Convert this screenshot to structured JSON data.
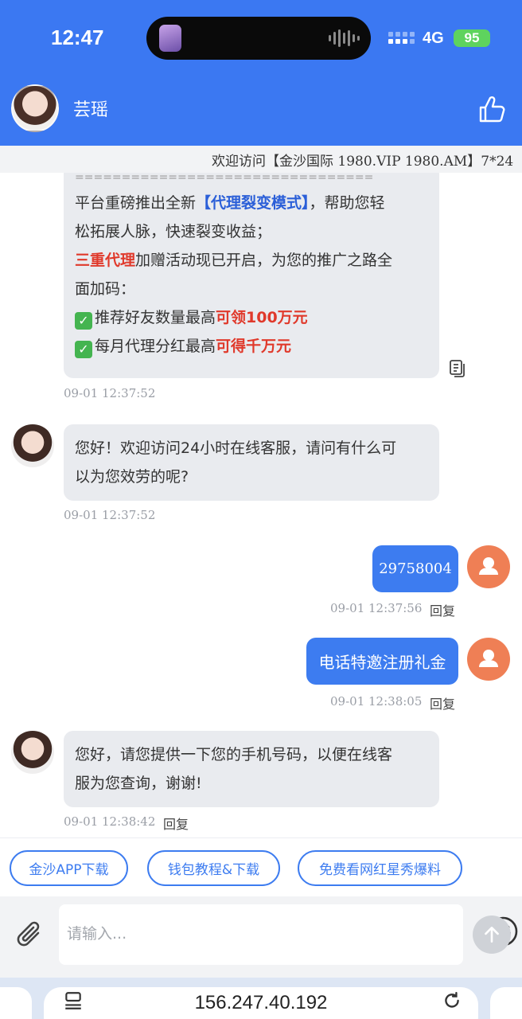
{
  "status_bar": {
    "time": "12:47",
    "network": "4G",
    "battery": "95"
  },
  "header": {
    "agent_name": "芸瑶"
  },
  "marquee": {
    "text": "欢迎访问【金沙国际 1980.VIP 1980.AM】7*24"
  },
  "messages": {
    "m1": {
      "divider": "================================",
      "l1a": "平台重磅推出全新",
      "l1b": "【代理裂变模式】",
      "l1c": "，帮助您轻",
      "l2": "松拓展人脉，快速裂变收益；",
      "l3a": "三重代理",
      "l3b": "加赠活动现已开启，为您的推广之路全",
      "l4": "面加码：",
      "l5a": "推荐好友数量最高",
      "l5b": "可领100万元",
      "l6a": "每月代理分红最高",
      "l6b": "可得千万元",
      "time": "09-01 12:37:52"
    },
    "m2": {
      "l1": "您好！欢迎访问24小时在线客服，请问有什么可",
      "l2": "以为您效劳的呢?",
      "time": "09-01 12:37:52"
    },
    "m3": {
      "text": "29758004",
      "time": "09-01 12:37:56",
      "reply": "回复"
    },
    "m4": {
      "text": "电话特邀注册礼金",
      "time": "09-01 12:38:05",
      "reply": "回复"
    },
    "m5": {
      "l1": "您好，请您提供一下您的手机号码，以便在线客",
      "l2": "服为您查询，谢谢!",
      "time": "09-01 12:38:42",
      "reply": "回复"
    }
  },
  "quick_buttons": [
    "金沙APP下载",
    "钱包教程&下载",
    "免费看网红星秀爆料"
  ],
  "input": {
    "placeholder": "请输入..."
  },
  "browser": {
    "url": "156.247.40.192"
  },
  "colors": {
    "header": "#3b78f2",
    "accent": "#3d7cf0",
    "user_avatar": "#ef7f55",
    "highlight_red": "#e0392b"
  }
}
